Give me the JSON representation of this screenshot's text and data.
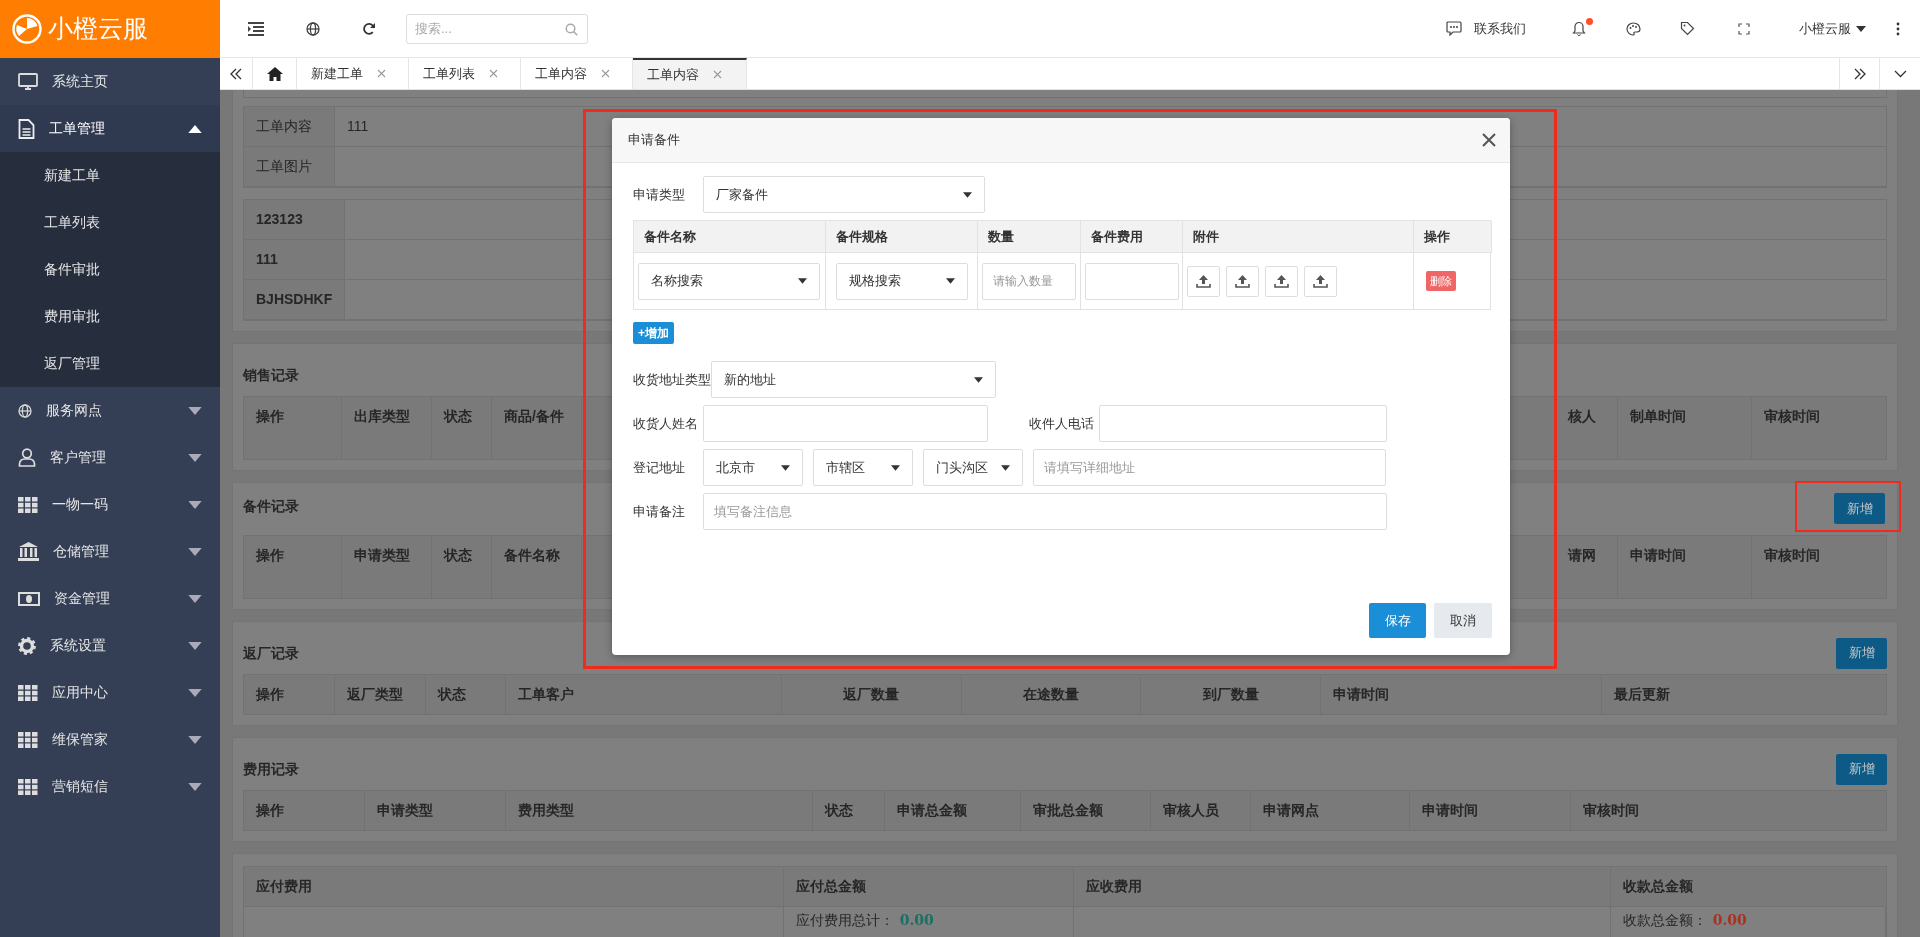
{
  "brand": {
    "name": "小橙云服"
  },
  "topbar": {
    "search": {
      "placeholder": "搜索..."
    },
    "contact": "联系我们",
    "notification_dot": true,
    "user": "小橙云服"
  },
  "tabs": [
    {
      "label": "新建工单",
      "selected": false
    },
    {
      "label": "工单列表",
      "selected": false
    },
    {
      "label": "工单内容",
      "selected": false
    },
    {
      "label": "工单内容",
      "selected": true
    }
  ],
  "sidebar": {
    "items": [
      {
        "label": "系统主页",
        "kind": "link"
      },
      {
        "label": "工单管理",
        "kind": "group",
        "expanded": true,
        "children": [
          {
            "label": "新建工单"
          },
          {
            "label": "工单列表"
          },
          {
            "label": "备件审批"
          },
          {
            "label": "费用审批"
          },
          {
            "label": "返厂管理"
          }
        ]
      },
      {
        "label": "服务网点",
        "kind": "group",
        "expanded": false
      },
      {
        "label": "客户管理",
        "kind": "group",
        "expanded": false
      },
      {
        "label": "一物一码",
        "kind": "group",
        "expanded": false
      },
      {
        "label": "仓储管理",
        "kind": "group",
        "expanded": false
      },
      {
        "label": "资金管理",
        "kind": "group",
        "expanded": false
      },
      {
        "label": "系统设置",
        "kind": "group",
        "expanded": false
      },
      {
        "label": "应用中心",
        "kind": "group",
        "expanded": false
      },
      {
        "label": "维保管家",
        "kind": "group",
        "expanded": false
      },
      {
        "label": "营销短信",
        "kind": "group",
        "expanded": false
      }
    ]
  },
  "detail": {
    "rows": [
      {
        "label": "工单内容",
        "value": "111"
      },
      {
        "label": "工单图片"
      }
    ],
    "codes": [
      {
        "label": "123123"
      },
      {
        "label": "111"
      },
      {
        "label": "BJHSDHKF"
      }
    ]
  },
  "sections": [
    {
      "title": "销售记录",
      "left_columns": [
        "操作",
        "出库类型",
        "状态",
        "商品/备件"
      ],
      "right_columns": [
        "核人",
        "制单时间",
        "审核时间"
      ]
    },
    {
      "title": "备件记录",
      "add_button": {
        "label": "新增",
        "highlighted": true
      },
      "left_columns": [
        "操作",
        "申请类型",
        "状态",
        "备件名称"
      ],
      "right_columns": [
        "请网",
        "申请时间",
        "审核时间"
      ]
    },
    {
      "title": "返厂记录",
      "add_button": {
        "label": "新增",
        "highlighted": false
      },
      "columns": [
        "操作",
        "返厂类型",
        "状态",
        "工单客户",
        "返厂数量",
        "在途数量",
        "到厂数量",
        "申请时间",
        "最后更新"
      ]
    },
    {
      "title": "费用记录",
      "add_button": {
        "label": "新增",
        "highlighted": false
      },
      "columns": [
        "操作",
        "申请类型",
        "费用类型",
        "状态",
        "申请总金额",
        "审批总金额",
        "审核人员",
        "申请网点",
        "申请时间",
        "审核时间"
      ]
    }
  ],
  "summary": {
    "columns": [
      {
        "title": "应付费用"
      },
      {
        "title": "应付总金额",
        "total": {
          "label": "应付费用总计：",
          "value": "0.00",
          "color": "#1b6f62"
        }
      },
      {
        "title": "应收费用"
      },
      {
        "title": "收款总金额",
        "total": {
          "label": "收款总金额：",
          "value": "0.00",
          "color": "#a8321f"
        }
      }
    ]
  },
  "modal": {
    "title": "申请备件",
    "highlighted": true,
    "apply_type": {
      "label": "申请类型",
      "value": "厂家备件"
    },
    "parts_table": {
      "columns": [
        "备件名称",
        "备件规格",
        "数量",
        "备件费用",
        "附件",
        "操作"
      ],
      "rows": [
        {
          "name": "名称搜索",
          "spec": "规格搜索",
          "quantity_placeholder": "请输入数量",
          "uploads": [
            {
              "uploaded": false
            },
            {
              "uploaded": false
            },
            {
              "uploaded": false
            },
            {
              "uploaded": false
            }
          ],
          "delete": "删除"
        }
      ]
    },
    "add_row": "+增加",
    "address_type": {
      "label": "收货地址类型",
      "value": "新的地址"
    },
    "receiver_name": {
      "label": "收货人姓名"
    },
    "receiver_phone": {
      "label": "收件人电话"
    },
    "address": {
      "label": "登记地址",
      "province": "北京市",
      "city": "市辖区",
      "district": "门头沟区",
      "detail_placeholder": "请填写详细地址"
    },
    "remark": {
      "label": "申请备注",
      "placeholder": "填写备注信息"
    },
    "buttons": [
      {
        "label": "保存",
        "kind": "primary"
      },
      {
        "label": "取消",
        "kind": "secondary"
      }
    ]
  }
}
